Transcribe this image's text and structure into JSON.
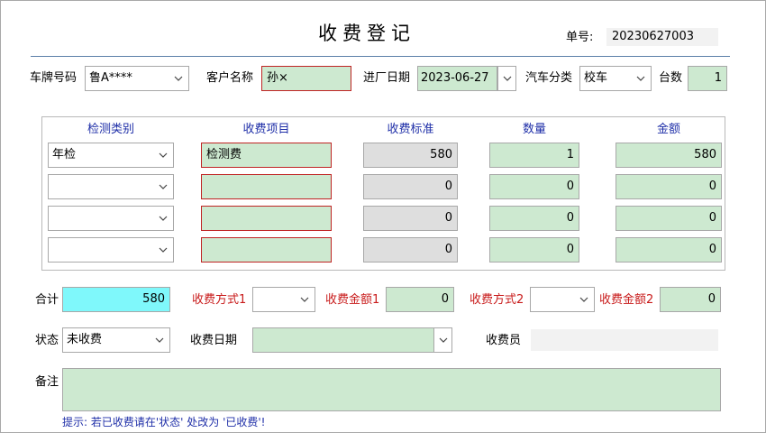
{
  "header": {
    "title": "收费登记",
    "doc_no_label": "单号:",
    "doc_no_value": "20230627003"
  },
  "form_top": {
    "plate_label": "车牌号码",
    "plate_value": "鲁A****",
    "customer_label": "客户名称",
    "customer_value": "孙×",
    "entry_date_label": "进厂日期",
    "entry_date_value": "2023-06-27",
    "vehicle_type_label": "汽车分类",
    "vehicle_type_value": "校车",
    "count_label": "台数",
    "count_value": "1"
  },
  "table": {
    "headers": [
      "检测类别",
      "收费项目",
      "收费标准",
      "数量",
      "金额"
    ],
    "rows": [
      {
        "category": "年检",
        "item": "检测费",
        "standard": "580",
        "qty": "1",
        "amount": "580"
      },
      {
        "category": "",
        "item": "",
        "standard": "0",
        "qty": "0",
        "amount": "0"
      },
      {
        "category": "",
        "item": "",
        "standard": "0",
        "qty": "0",
        "amount": "0"
      },
      {
        "category": "",
        "item": "",
        "standard": "0",
        "qty": "0",
        "amount": "0"
      }
    ]
  },
  "summary": {
    "total_label": "合计",
    "total_value": "580",
    "pay_method1_label": "收费方式1",
    "pay_method1_value": "",
    "pay_amount1_label": "收费金额1",
    "pay_amount1_value": "0",
    "pay_method2_label": "收费方式2",
    "pay_method2_value": "",
    "pay_amount2_label": "收费金额2",
    "pay_amount2_value": "0"
  },
  "status_row": {
    "status_label": "状态",
    "status_value": "未收费",
    "pay_date_label": "收费日期",
    "pay_date_value": "",
    "cashier_label": "收费员",
    "cashier_value": ""
  },
  "notes": {
    "label": "备注",
    "value": ""
  },
  "hint": "提示: 若已收费请在'状态' 处改为 '已收费'!",
  "colors": {
    "green_field": "#cde9d0",
    "gray_field": "#dedede",
    "cyan_field": "#7ff8fb",
    "red_label": "#c81a1a",
    "blue_header": "#1f2fa8"
  }
}
